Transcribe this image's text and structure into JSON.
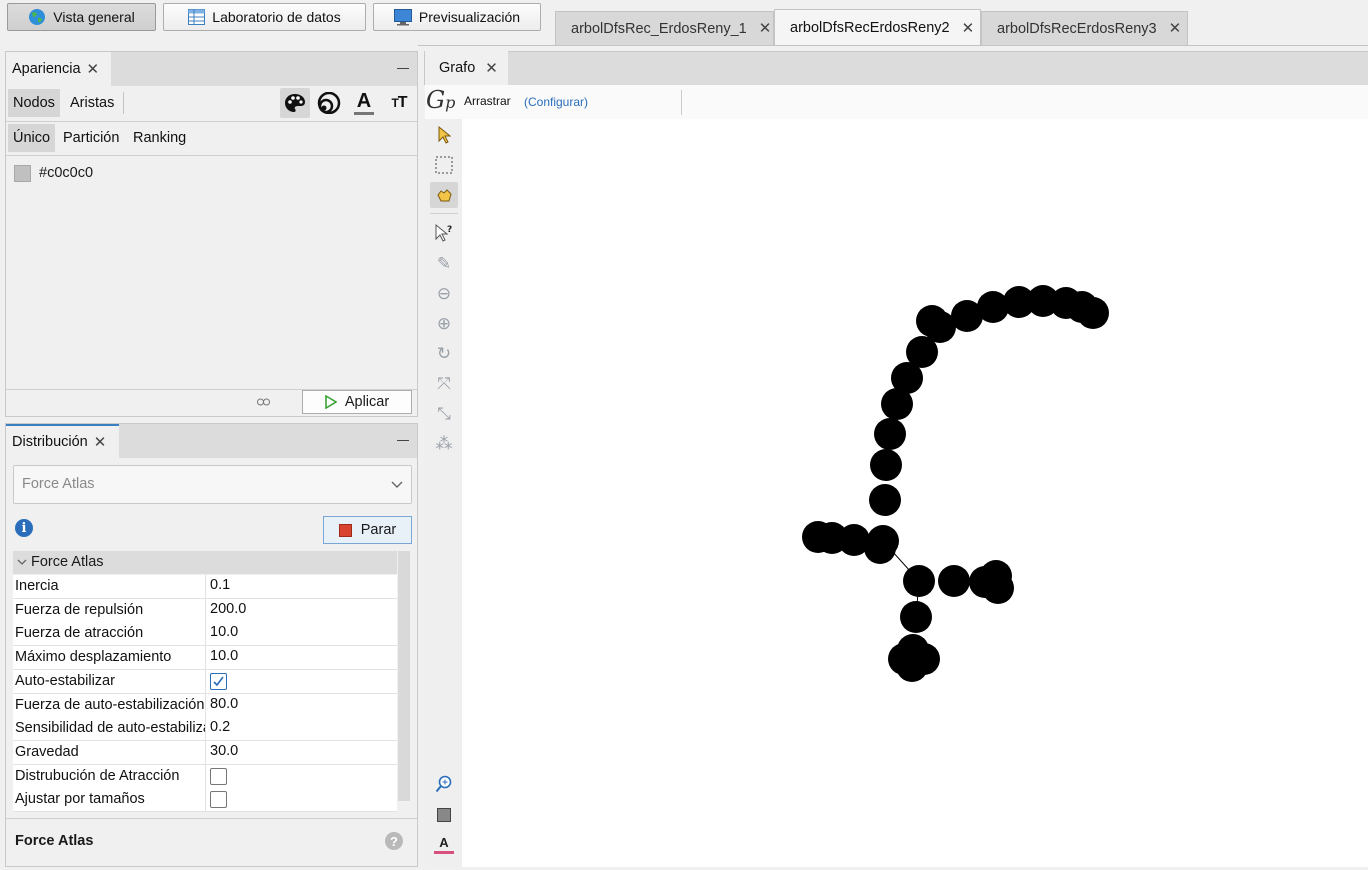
{
  "toolbar": {
    "overview": "Vista general",
    "data_lab": "Laboratorio de datos",
    "preview": "Previsualización"
  },
  "doc_tabs": [
    "arbolDfsRec_ErdosReny_1",
    "arbolDfsRecErdosReny2",
    "arbolDfsRecErdosReny3"
  ],
  "appearance": {
    "title": "Apariencia",
    "nodes": "Nodos",
    "edges": "Aristas",
    "unique": "Único",
    "partition": "Partición",
    "ranking": "Ranking",
    "color_value": "#c0c0c0",
    "apply": "Aplicar"
  },
  "layout": {
    "title": "Distribución",
    "algorithm": "Force Atlas",
    "stop": "Parar",
    "section": "Force Atlas",
    "props": [
      {
        "name": "Inercia",
        "value": "0.1"
      },
      {
        "name": "Fuerza de repulsión",
        "value": "200.0"
      },
      {
        "name": "Fuerza de atracción",
        "value": "10.0"
      },
      {
        "name": "Máximo desplazamiento",
        "value": "10.0"
      },
      {
        "name": "Auto-estabilizar",
        "checked": true
      },
      {
        "name": "Fuerza de auto-estabilización",
        "value": "80.0"
      },
      {
        "name": "Sensibilidad de auto-estabilización",
        "value": "0.2"
      },
      {
        "name": "Gravedad",
        "value": "30.0"
      },
      {
        "name": "Distrubución de Atracción",
        "checked": false
      },
      {
        "name": "Ajustar por tamaños",
        "checked": false
      }
    ],
    "footer": "Force Atlas"
  },
  "graph": {
    "title": "Grafo",
    "mode": "Arrastrar",
    "configure": "(Configurar)"
  },
  "colors": {
    "accent": "#3c7fc1",
    "link": "#2a6ebb",
    "node": "#000000",
    "stop_red": "#d9442e",
    "apply_green": "#3aa336"
  }
}
